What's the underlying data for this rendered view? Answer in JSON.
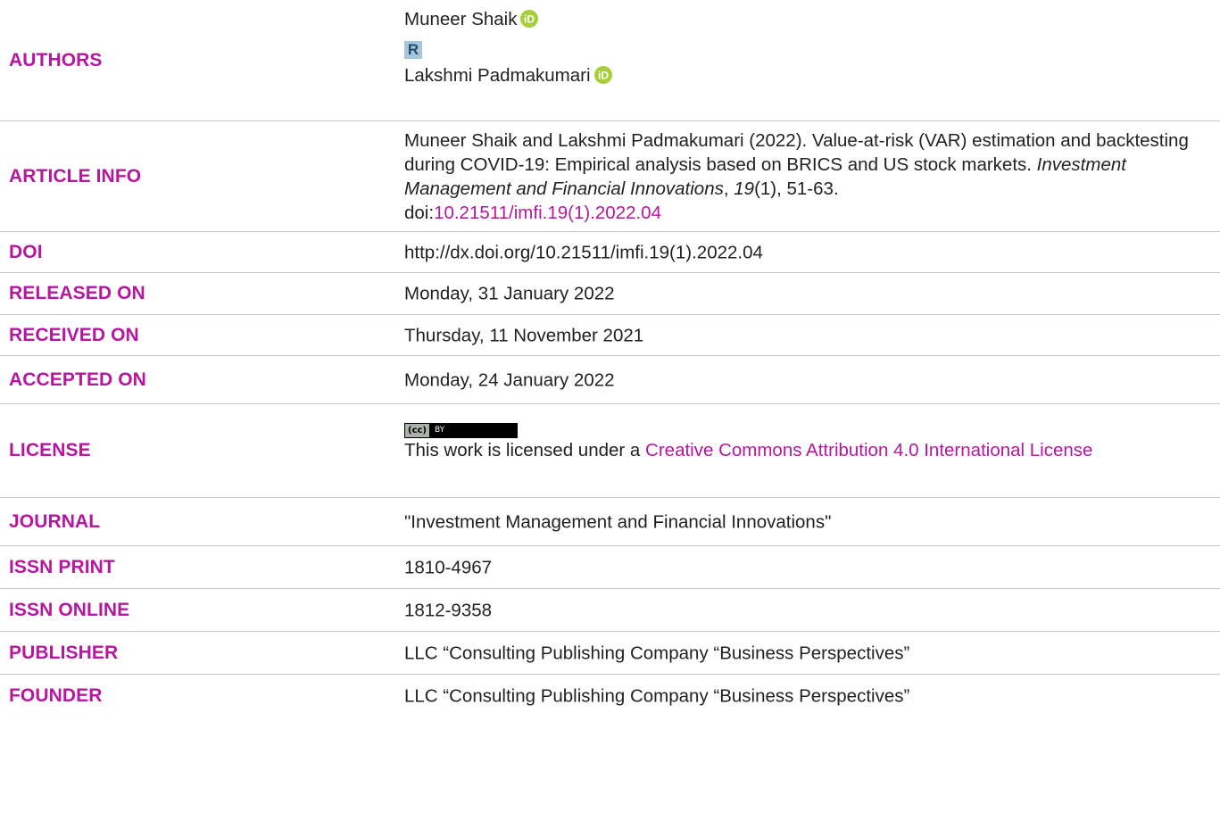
{
  "authors": {
    "label": "AUTHORS",
    "names": [
      "Muneer Shaik",
      "Lakshmi Padmakumari"
    ],
    "researcher_icon_letter": "R"
  },
  "article_info": {
    "label": "ARTICLE INFO",
    "citation_prefix": "Muneer Shaik and Lakshmi Padmakumari (2022). Value-at-risk (VAR) estimation and backtesting during COVID-19: Empirical analysis based on BRICS and US stock markets. ",
    "journal_italic": "Investment Management and Financial Innovations",
    "comma": ", ",
    "volume_italic": "19",
    "citation_suffix": "(1), 51-63.",
    "doi_prefix": "doi:",
    "doi_link": "10.21511/imfi.19(1).2022.04"
  },
  "doi": {
    "label": "DOI",
    "value": "http://dx.doi.org/10.21511/imfi.19(1).2022.04"
  },
  "released_on": {
    "label": "RELEASED ON",
    "value": "Monday, 31 January 2022"
  },
  "received_on": {
    "label": "RECEIVED ON",
    "value": "Thursday, 11 November 2021"
  },
  "accepted_on": {
    "label": "ACCEPTED ON",
    "value": "Monday, 24 January 2022"
  },
  "license": {
    "label": "LICENSE",
    "badge_left": "(cc)",
    "badge_right": "BY",
    "text_prefix": "This work is licensed under a ",
    "link_text": "Creative Commons Attribution 4.0 International License"
  },
  "journal": {
    "label": "JOURNAL",
    "value": "\"Investment Management and Financial Innovations\""
  },
  "issn_print": {
    "label": "ISSN PRINT",
    "value": "1810-4967"
  },
  "issn_online": {
    "label": "ISSN ONLINE",
    "value": "1812-9358"
  },
  "publisher": {
    "label": "PUBLISHER",
    "value": "LLC “Consulting Publishing Company “Business Perspectives”"
  },
  "founder": {
    "label": "FOUNDER",
    "value": "LLC “Consulting Publishing Company “Business Perspectives”"
  },
  "colors": {
    "label": "#b5179e",
    "text": "#231f20",
    "divider": "#c8c8c8",
    "orcid": "#a6ce39"
  }
}
